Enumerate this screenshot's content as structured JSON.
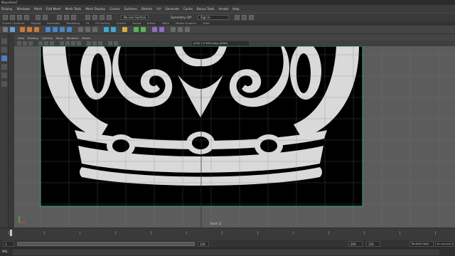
{
  "app": {
    "title": "MayaView7"
  },
  "menubar": {
    "items": [
      "Display",
      "Windows",
      "Mesh",
      "Edit Mesh",
      "Mesh Tools",
      "Mesh Display",
      "Curves",
      "Surfaces",
      "Deform",
      "UV",
      "Generate",
      "Cache",
      "Bonus Tools",
      "Arnold",
      "Help"
    ],
    "workspace_field": "No Live Surface",
    "symmetry": "Symmetry: Off",
    "sign_in": "Sign In"
  },
  "shelf_tabs": [
    "Curves / Surfaces",
    "Rigging",
    "Animation",
    "Rendering",
    "FX",
    "FX Caching",
    "Custom",
    "Arnold",
    "Bifrost",
    "MASH",
    "Motion Graphics",
    "XGen"
  ],
  "panel_menu": [
    "View",
    "Shading",
    "Lighting",
    "Show",
    "Renderer",
    "Panels"
  ],
  "panel_bar": {
    "field_value": "ACES 1.0 SDR-video (sRGB)"
  },
  "viewport": {
    "camera_label": "front -Z",
    "background_color": "#5c5c5c",
    "plane_color": "#000000",
    "shape_color": "#d9d9d9",
    "border_color": "#2fae7a"
  },
  "timeslider": {
    "frames": [
      "1",
      "10",
      "20",
      "30",
      "40",
      "50",
      "60",
      "70",
      "80",
      "90",
      "100",
      "110",
      "120"
    ]
  },
  "range": {
    "start": "1",
    "end": "120",
    "total": "200",
    "anim_layer": "No Anim Layer",
    "char_set": "No Character Set"
  },
  "command_line": {
    "language": "MEL"
  }
}
